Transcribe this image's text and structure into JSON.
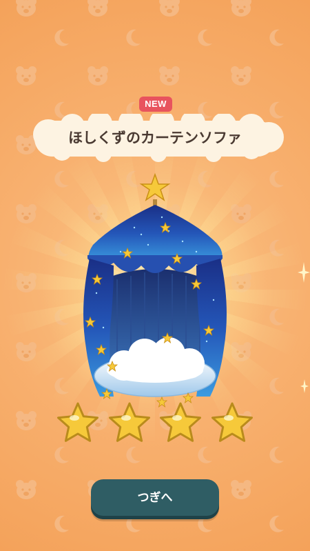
{
  "badge": {
    "label": "NEW"
  },
  "item": {
    "name": "ほしくずのカーテンソファ",
    "rarity_stars": 4,
    "rarity_max": 4
  },
  "actions": {
    "next_label": "つぎへ"
  },
  "colors": {
    "background": "#f6a964",
    "badge": "#e8535e",
    "button": "#2f5d64",
    "star_fill": "#f6c93a",
    "tent": "#1e3f9e"
  },
  "icons": {
    "background_pattern": [
      "bear-face-icon",
      "crescent-moon-icon"
    ],
    "rating": "star-icon",
    "topper": "star-icon"
  }
}
